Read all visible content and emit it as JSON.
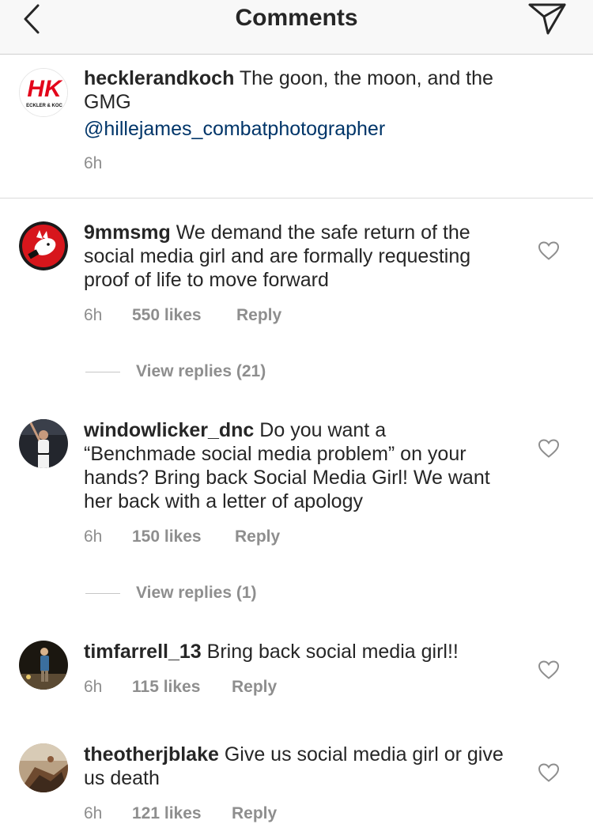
{
  "header": {
    "title": "Comments"
  },
  "caption": {
    "username": "hecklerandkoch",
    "text": " The goon, the moon, and the GMG",
    "mention": "@hillejames_combatphotographer",
    "time": "6h",
    "logo_text": "HK",
    "logo_subtext": "ECKLER & KOC"
  },
  "comments": [
    {
      "username": "9mmsmg",
      "text": " We demand the safe return of the social media girl and are formally requesting proof of life to move forward",
      "time": "6h",
      "likes": "550 likes",
      "reply": "Reply",
      "view_replies": "View replies (21)"
    },
    {
      "username": "windowlicker_dnc",
      "text": " Do you want a “Benchmade social  media problem” on your hands?  Bring back Social Media Girl! We want her back with a letter of apology",
      "time": "6h",
      "likes": "150 likes",
      "reply": "Reply",
      "view_replies": "View replies (1)"
    },
    {
      "username": "timfarrell_13",
      "text": " Bring back social media girl!!",
      "time": "6h",
      "likes": "115 likes",
      "reply": "Reply"
    },
    {
      "username": "theotherjblake",
      "text": " Give us social media girl or give us death",
      "time": "6h",
      "likes": "121 likes",
      "reply": "Reply"
    }
  ],
  "icons": {
    "back": "chevron-left-icon",
    "share": "paper-plane-icon",
    "like": "heart-outline-icon"
  },
  "colors": {
    "mention": "#003569",
    "hk_red": "#e3051b",
    "meta_gray": "#8e8e8e"
  }
}
